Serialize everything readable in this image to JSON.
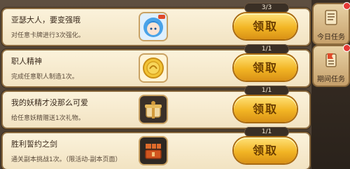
{
  "tasks": [
    {
      "title": "亚瑟大人，要变强哦",
      "description": "对任意卡牌进行3次强化。",
      "progress": "3/3",
      "claim_label": "领取",
      "icon": "character-portrait-icon"
    },
    {
      "title": "职人精神",
      "description": "完成任意职人制造1次。",
      "progress": "1/1",
      "claim_label": "领取",
      "icon": "coin-emblem-icon"
    },
    {
      "title": "我的妖精才没那么可爱",
      "description": "给任意妖精赠送1次礼物。",
      "progress": "1/1",
      "claim_label": "领取",
      "icon": "gift-item-icon"
    },
    {
      "title": "胜利誓约之剑",
      "description": "通关副本挑战1次。（限活动-副本页面）",
      "progress": "1/1",
      "claim_label": "领取",
      "icon": "treasure-chest-icon"
    }
  ],
  "sidebar": {
    "tabs": [
      {
        "label": "今日任务",
        "icon": "scroll-icon"
      },
      {
        "label": "期间任务",
        "icon": "flag-scroll-icon"
      }
    ]
  }
}
